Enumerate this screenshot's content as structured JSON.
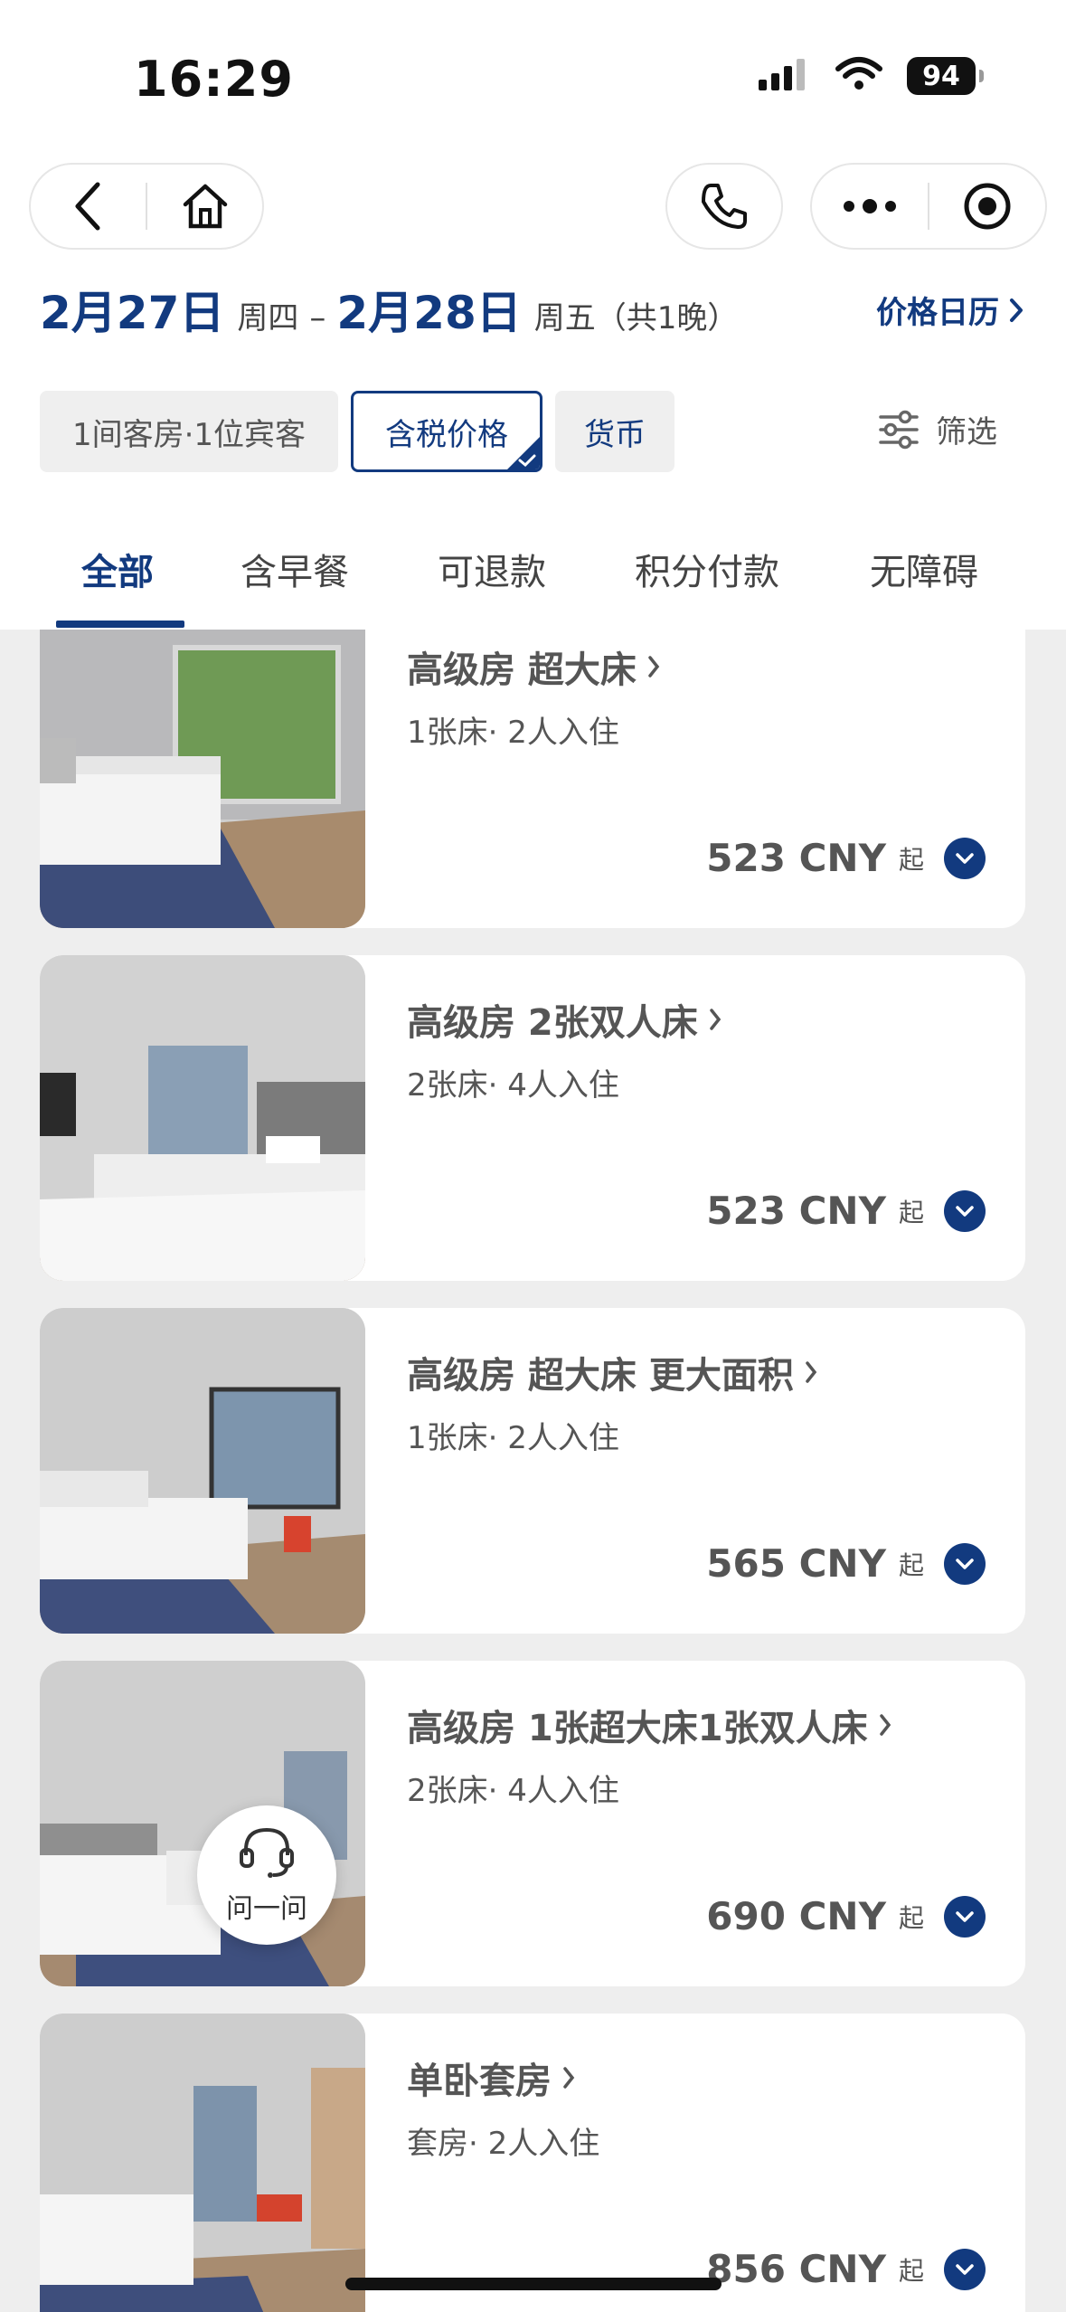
{
  "status_bar": {
    "time": "16:29",
    "battery": "94"
  },
  "nav": {
    "back_icon": "chevron-left-icon",
    "home_icon": "home-icon",
    "phone_icon": "phone-icon",
    "more_icon": "more-dots-icon",
    "target_icon": "record-target-icon"
  },
  "dates": {
    "checkin": "2月27日",
    "checkin_weekday": "周四",
    "dash": "–",
    "checkout": "2月28日",
    "checkout_weekday": "周五（共1晚）",
    "calendar_link": "价格日历"
  },
  "chips": {
    "guests": "1间客房·1位宾客",
    "tax": "含税价格",
    "currency": "货币",
    "filter": "筛选"
  },
  "tabs": [
    {
      "label": "全部",
      "active": true
    },
    {
      "label": "含早餐",
      "active": false
    },
    {
      "label": "可退款",
      "active": false
    },
    {
      "label": "积分付款",
      "active": false
    },
    {
      "label": "无障碍",
      "active": false
    }
  ],
  "rooms": [
    {
      "title": "高级房 超大床",
      "sub": "1张床· 2人入住",
      "price": "523 CNY",
      "from": "起"
    },
    {
      "title": "高级房 2张双人床",
      "sub": "2张床· 4人入住",
      "price": "523 CNY",
      "from": "起"
    },
    {
      "title": "高级房 超大床 更大面积",
      "sub": "1张床· 2人入住",
      "price": "565 CNY",
      "from": "起"
    },
    {
      "title": "高级房 1张超大床1张双人床",
      "sub": "2张床· 4人入住",
      "price": "690 CNY",
      "from": "起"
    },
    {
      "title": "单卧套房",
      "sub": "套房· 2人入住",
      "price": "856 CNY",
      "from": "起"
    }
  ],
  "help": {
    "label": "问一问"
  },
  "colors": {
    "brand": "#123a7f",
    "background": "#eeeeee",
    "card": "#ffffff"
  }
}
